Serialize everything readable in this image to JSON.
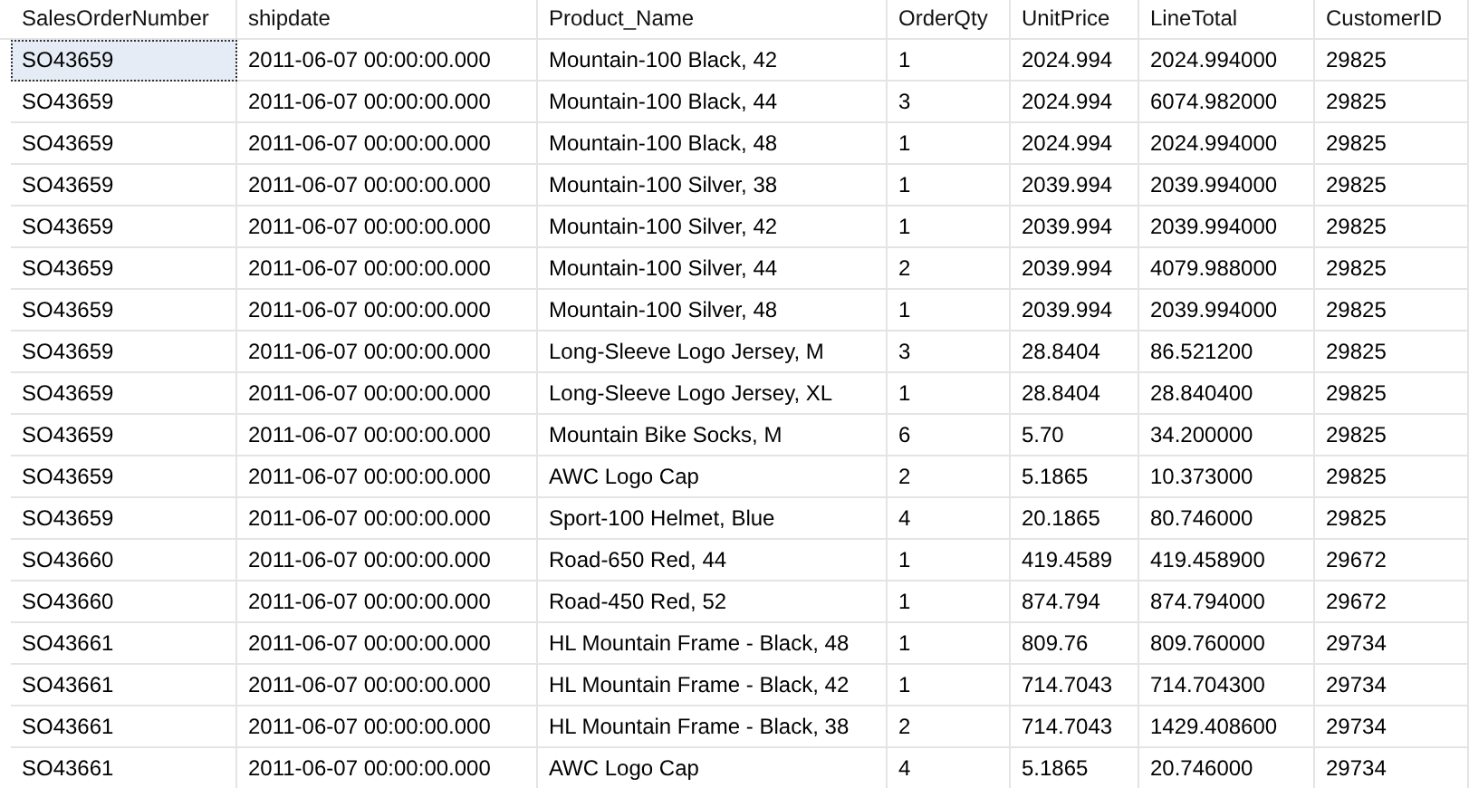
{
  "grid": {
    "columns": [
      "SalesOrderNumber",
      "shipdate",
      "Product_Name",
      "OrderQty",
      "UnitPrice",
      "LineTotal",
      "CustomerID"
    ],
    "rows": [
      {
        "selected": true,
        "cells": [
          "SO43659",
          "2011-06-07 00:00:00.000",
          "Mountain-100 Black, 42",
          "1",
          "2024.994",
          "2024.994000",
          "29825"
        ]
      },
      {
        "selected": false,
        "cells": [
          "SO43659",
          "2011-06-07 00:00:00.000",
          "Mountain-100 Black, 44",
          "3",
          "2024.994",
          "6074.982000",
          "29825"
        ]
      },
      {
        "selected": false,
        "cells": [
          "SO43659",
          "2011-06-07 00:00:00.000",
          "Mountain-100 Black, 48",
          "1",
          "2024.994",
          "2024.994000",
          "29825"
        ]
      },
      {
        "selected": false,
        "cells": [
          "SO43659",
          "2011-06-07 00:00:00.000",
          "Mountain-100 Silver, 38",
          "1",
          "2039.994",
          "2039.994000",
          "29825"
        ]
      },
      {
        "selected": false,
        "cells": [
          "SO43659",
          "2011-06-07 00:00:00.000",
          "Mountain-100 Silver, 42",
          "1",
          "2039.994",
          "2039.994000",
          "29825"
        ]
      },
      {
        "selected": false,
        "cells": [
          "SO43659",
          "2011-06-07 00:00:00.000",
          "Mountain-100 Silver, 44",
          "2",
          "2039.994",
          "4079.988000",
          "29825"
        ]
      },
      {
        "selected": false,
        "cells": [
          "SO43659",
          "2011-06-07 00:00:00.000",
          "Mountain-100 Silver, 48",
          "1",
          "2039.994",
          "2039.994000",
          "29825"
        ]
      },
      {
        "selected": false,
        "cells": [
          "SO43659",
          "2011-06-07 00:00:00.000",
          "Long-Sleeve Logo Jersey, M",
          "3",
          "28.8404",
          "86.521200",
          "29825"
        ]
      },
      {
        "selected": false,
        "cells": [
          "SO43659",
          "2011-06-07 00:00:00.000",
          "Long-Sleeve Logo Jersey, XL",
          "1",
          "28.8404",
          "28.840400",
          "29825"
        ]
      },
      {
        "selected": false,
        "cells": [
          "SO43659",
          "2011-06-07 00:00:00.000",
          "Mountain Bike Socks, M",
          "6",
          "5.70",
          "34.200000",
          "29825"
        ]
      },
      {
        "selected": false,
        "cells": [
          "SO43659",
          "2011-06-07 00:00:00.000",
          "AWC Logo Cap",
          "2",
          "5.1865",
          "10.373000",
          "29825"
        ]
      },
      {
        "selected": false,
        "cells": [
          "SO43659",
          "2011-06-07 00:00:00.000",
          "Sport-100 Helmet, Blue",
          "4",
          "20.1865",
          "80.746000",
          "29825"
        ]
      },
      {
        "selected": false,
        "cells": [
          "SO43660",
          "2011-06-07 00:00:00.000",
          "Road-650 Red, 44",
          "1",
          "419.4589",
          "419.458900",
          "29672"
        ]
      },
      {
        "selected": false,
        "cells": [
          "SO43660",
          "2011-06-07 00:00:00.000",
          "Road-450 Red, 52",
          "1",
          "874.794",
          "874.794000",
          "29672"
        ]
      },
      {
        "selected": false,
        "cells": [
          "SO43661",
          "2011-06-07 00:00:00.000",
          "HL Mountain Frame - Black, 48",
          "1",
          "809.76",
          "809.760000",
          "29734"
        ]
      },
      {
        "selected": false,
        "cells": [
          "SO43661",
          "2011-06-07 00:00:00.000",
          "HL Mountain Frame - Black, 42",
          "1",
          "714.7043",
          "714.704300",
          "29734"
        ]
      },
      {
        "selected": false,
        "cells": [
          "SO43661",
          "2011-06-07 00:00:00.000",
          "HL Mountain Frame - Black, 38",
          "2",
          "714.7043",
          "1429.408600",
          "29734"
        ]
      },
      {
        "selected": false,
        "cells": [
          "SO43661",
          "2011-06-07 00:00:00.000",
          "AWC Logo Cap",
          "4",
          "5.1865",
          "20.746000",
          "29734"
        ]
      }
    ]
  }
}
